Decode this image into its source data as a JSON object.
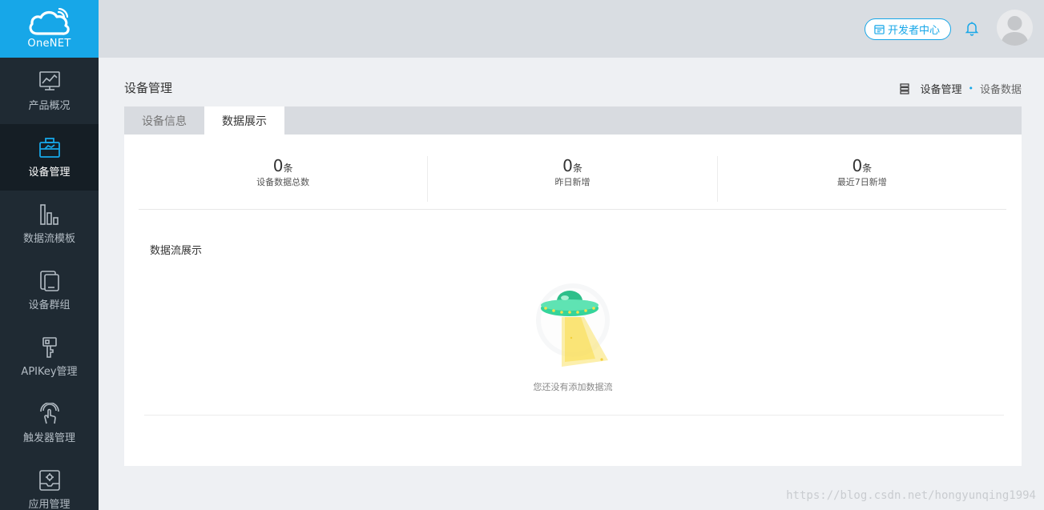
{
  "app": {
    "logo_text": "OneNET",
    "accent_color": "#17a7e8",
    "sidebar_color": "#1f2a33"
  },
  "sidebar": {
    "items": [
      {
        "label": "产品概况",
        "icon": "chart-line-icon",
        "active": false
      },
      {
        "label": "设备管理",
        "icon": "toolbox-icon",
        "active": true
      },
      {
        "label": "数据流模板",
        "icon": "bar-columns-icon",
        "active": false
      },
      {
        "label": "设备群组",
        "icon": "device-group-icon",
        "active": false
      },
      {
        "label": "APIKey管理",
        "icon": "key-icon",
        "active": false
      },
      {
        "label": "触发器管理",
        "icon": "touch-trigger-icon",
        "active": false
      },
      {
        "label": "应用管理",
        "icon": "app-gear-icon",
        "active": false
      }
    ]
  },
  "header": {
    "dev_center_label": "开发者中心",
    "dev_center_icon": "calendar-icon",
    "bell_icon": "bell-icon",
    "avatar_icon": "user-avatar-icon"
  },
  "page": {
    "title": "设备管理",
    "breadcrumb": {
      "icon": "list-icon",
      "parent": "设备管理",
      "separator": "•",
      "current": "设备数据"
    }
  },
  "tabs": [
    {
      "label": "设备信息",
      "active": false
    },
    {
      "label": "数据展示",
      "active": true
    }
  ],
  "stats": [
    {
      "value": "0",
      "unit": "条",
      "label": "设备数据总数"
    },
    {
      "value": "0",
      "unit": "条",
      "label": "昨日新增"
    },
    {
      "value": "0",
      "unit": "条",
      "label": "最近7日新增"
    }
  ],
  "datastream": {
    "section_title": "数据流展示",
    "empty_icon": "ufo-empty-icon",
    "empty_text": "您还没有添加数据流"
  },
  "watermark": "https://blog.csdn.net/hongyunqing1994"
}
